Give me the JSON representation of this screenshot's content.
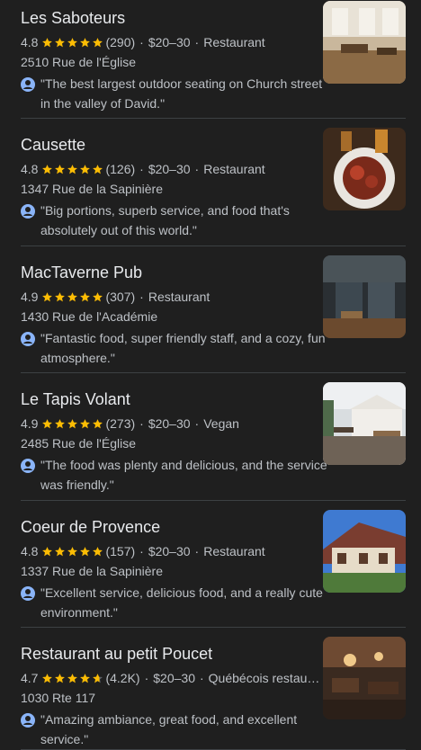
{
  "results": [
    {
      "name": "Les Saboteurs",
      "rating": "4.8",
      "reviews": "(290)",
      "price": "$20–30",
      "category": "Restaurant",
      "address": "2510 Rue de l'Église",
      "review": "\"The best largest outdoor seating on Church street in the valley of David.\"",
      "photo": "interior-wood-icon",
      "stars": [
        1,
        1,
        1,
        1,
        1
      ]
    },
    {
      "name": "Causette",
      "rating": "4.8",
      "reviews": "(126)",
      "price": "$20–30",
      "category": "Restaurant",
      "address": "1347 Rue de la Sapinière",
      "review": "\"Big portions, superb service, and food that's absolutely out of this world.\"",
      "photo": "food-plate-icon",
      "stars": [
        1,
        1,
        1,
        1,
        1
      ]
    },
    {
      "name": "MacTaverne Pub",
      "rating": "4.9",
      "reviews": "(307)",
      "price": "",
      "category": "Restaurant",
      "address": "1430 Rue de l'Académie",
      "review": "\"Fantastic food, super friendly staff, and a cozy, fun atmosphere.\"",
      "photo": "pub-interior-icon",
      "stars": [
        1,
        1,
        1,
        1,
        1
      ]
    },
    {
      "name": "Le Tapis Volant",
      "rating": "4.9",
      "reviews": "(273)",
      "price": "$20–30",
      "category": "Vegan",
      "address": "2485 Rue de l'Église",
      "review": "\"The food was plenty and delicious, and the service was friendly.\"",
      "photo": "patio-exterior-icon",
      "stars": [
        1,
        1,
        1,
        1,
        1
      ]
    },
    {
      "name": "Coeur de Provence",
      "rating": "4.8",
      "reviews": "(157)",
      "price": "$20–30",
      "category": "Restaurant",
      "address": "1337 Rue de la Sapinière",
      "review": "\"Excellent service, delicious food, and a really cute environment.\"",
      "photo": "building-exterior-icon",
      "stars": [
        1,
        1,
        1,
        1,
        1
      ]
    },
    {
      "name": "Restaurant au petit Poucet",
      "rating": "4.7",
      "reviews": "(4.2K)",
      "price": "$20–30",
      "category": "Québécois restaurant",
      "address": "1030 Rte 117",
      "review": "\"Amazing ambiance, great food, and excellent service.\"",
      "photo": "dining-hall-icon",
      "stars": [
        1,
        1,
        1,
        1,
        0.7
      ]
    }
  ],
  "colors": {
    "star": "#fbbc04",
    "star_empty": "#5f6368",
    "background": "#1f1f1f",
    "accent": "#8ab4f8"
  }
}
